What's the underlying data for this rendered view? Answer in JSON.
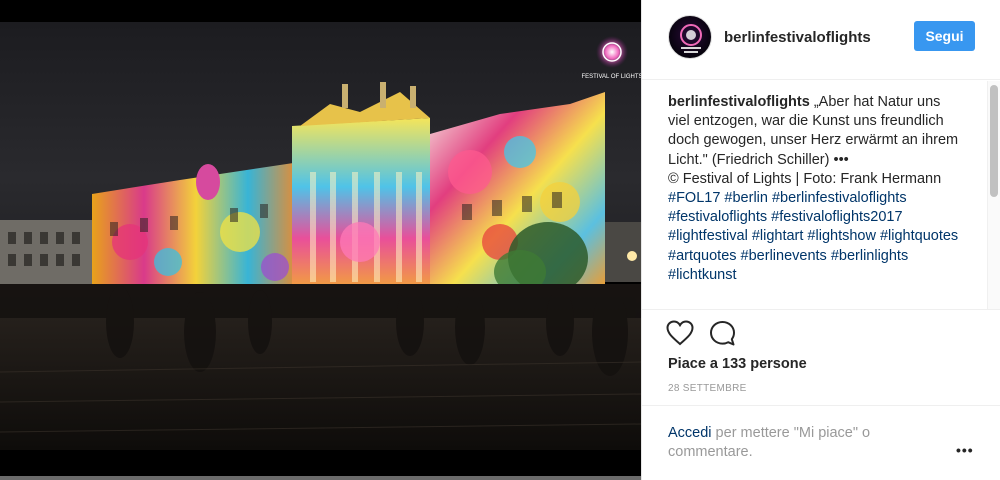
{
  "post": {
    "username": "berlinfestivaloflights",
    "follow_label": "Segui",
    "watermark_text": "FESTIVAL OF LIGHTS"
  },
  "caption": {
    "username": "berlinfestivaloflights",
    "quote": "„Aber hat Natur uns viel entzogen, war die Kunst uns freundlich doch gewogen, unser Herz erwärmt an ihrem Licht.\" (Friedrich Schiller)",
    "bullets": "•••",
    "credit": "© Festival of Lights | Foto: Frank Hermann",
    "hashtags": "#FOL17 #berlin #berlinfestivaloflights #festivaloflights #festivaloflights2017 #lightfestival #lightart #lightshow #lightquotes #artquotes #berlinevents #berlinlights #lichtkunst"
  },
  "actions": {
    "likes_text": "Piace a 133 persone",
    "date": "28 SETTEMBRE"
  },
  "login": {
    "link": "Accedi",
    "rest": " per mettere \"Mi piace\" o commentare.",
    "more": "•••"
  },
  "icons": {
    "like": "heart-icon",
    "comment": "comment-icon",
    "more": "more-options-icon"
  },
  "colors": {
    "follow_button": "#3897f0",
    "hashtag_link": "#003569",
    "muted": "#999999"
  }
}
